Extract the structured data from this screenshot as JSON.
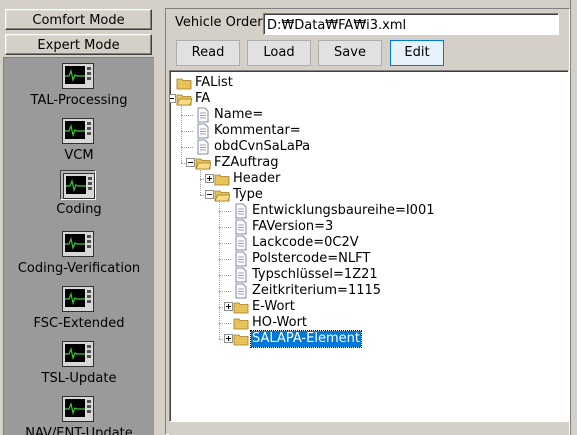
{
  "sidebar": {
    "modes": {
      "comfort": "Comfort Mode",
      "expert": "Expert Mode"
    },
    "items": [
      {
        "label": "TAL-Processing",
        "icon": "monitor-heartbeat-icon"
      },
      {
        "label": "VCM",
        "icon": "monitor-heartbeat-icon"
      },
      {
        "label": "Coding",
        "icon": "monitor-heartbeat-icon",
        "selected": true
      },
      {
        "label": "Coding-Verification",
        "icon": "monitor-heartbeat-icon"
      },
      {
        "label": "FSC-Extended",
        "icon": "monitor-heartbeat-icon"
      },
      {
        "label": "TSL-Update",
        "icon": "monitor-heartbeat-icon"
      },
      {
        "label": "NAV/ENT-Update",
        "icon": "monitor-heartbeat-icon"
      }
    ]
  },
  "vehicle_order": {
    "label": "Vehicle Order",
    "value": "D:₩Data₩FA₩i3.xml"
  },
  "toolbar": {
    "read": "Read",
    "load": "Load",
    "save": "Save",
    "edit": "Edit"
  },
  "tree": [
    {
      "text": "FAList",
      "type": "folder"
    },
    {
      "text": "FA",
      "type": "folder",
      "expanded": true
    },
    {
      "text": "Name=",
      "type": "document"
    },
    {
      "text": "Kommentar=",
      "type": "document"
    },
    {
      "text": "obdCvnSaLaPa",
      "type": "document"
    },
    {
      "text": "FZAuftrag",
      "type": "folder",
      "expanded": true
    },
    {
      "text": "Header",
      "type": "folder",
      "expanded": false
    },
    {
      "text": "Type",
      "type": "folder",
      "expanded": true
    },
    {
      "text": "Entwicklungsbaureihe=I001",
      "type": "document"
    },
    {
      "text": "FAVersion=3",
      "type": "document"
    },
    {
      "text": "Lackcode=0C2V",
      "type": "document"
    },
    {
      "text": "Polstercode=NLFT",
      "type": "document"
    },
    {
      "text": "Typschlüssel=1Z21",
      "type": "document"
    },
    {
      "text": "Zeitkriterium=1115",
      "type": "document"
    },
    {
      "text": "E-Wort",
      "type": "folder",
      "expanded": false
    },
    {
      "text": "HO-Wort",
      "type": "folder"
    },
    {
      "text": "SALAPA-Element",
      "type": "folder",
      "expanded": false,
      "selected": true
    }
  ],
  "colors": {
    "window_bg": "#d4d0c8",
    "nav_bg": "#9a9a9a",
    "selection": "#0078d7",
    "folder": "#e8c35a",
    "monitor_trace": "#3cc83c"
  }
}
